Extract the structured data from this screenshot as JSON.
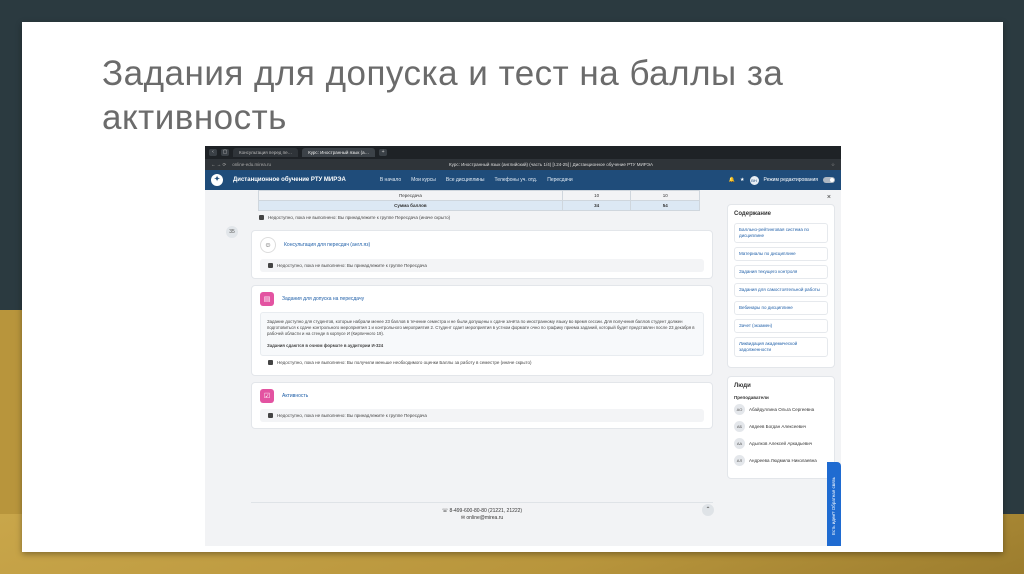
{
  "slide": {
    "title": "Задания для допуска и тест на баллы за активность"
  },
  "browser": {
    "tabs": [
      "Консультация перед пе…",
      "Курс: Иностранный язык (а…"
    ],
    "url": "online-edu.mirea.ru",
    "page_title": "Курс: Иностранный язык (английский) (часть 1/4) [I.24-25] | Дистанционное обучение РТУ МИРЭА"
  },
  "appbar": {
    "brand": "Дистанционное обучение РТУ МИРЭА",
    "nav": [
      "В начало",
      "Мои курсы",
      "Все дисциплины",
      "Телефоны уч. отд.",
      "Пересдачи"
    ],
    "avatar": "ВН",
    "edit_mode": "Режим редактирования"
  },
  "left_btn": "35",
  "table": {
    "rows": [
      [
        "Пересдача",
        "10",
        "10"
      ],
      [
        "Сумма баллов",
        "34",
        "54"
      ]
    ]
  },
  "main": {
    "restrict1": "Недоступно, пока не выполнено: Вы принадлежите к группе Пересдача (иначе скрыто)",
    "consult_link": "Консультация для пересдач (англ.яз)",
    "restrict2": "Недоступно, пока не выполнено: Вы принадлежите к группе Пересдача",
    "assign_link": "Задания для допуска на пересдачу",
    "desc_text": "Задание доступно для студентов, которые набрали менее 23 баллов в течение семестра и не были допущены к сдаче зачёта по иностранному языку во время сессии. Для получения баллов студент должен подготовиться к сдаче контрольного мероприятия 1 и контрольного мероприятия 2. Студент сдает мероприятия в устном формате очно по графику приема заданий, который будет представлен после 23 декабря в рабочей области и на стенде в корпусе И (Кирпичного 19).",
    "desc_bold": "Задания сдаются в очном формате в аудитории И-324",
    "restrict3": "Недоступно, пока не выполнено: Вы получили меньше необходимого оценки Баллы за работу в семестре (иначе скрыто)",
    "activity_link": "Активность",
    "restrict4": "Недоступно, пока не выполнено: Вы принадлежите к группе Пересдача"
  },
  "footer": {
    "phone": "8-499-600-80-80 (21221, 21222)",
    "email": "online@mirea.ru"
  },
  "sidebar": {
    "contents_title": "Содержание",
    "toc": [
      "Балльно-рейтинговая система по дисциплине",
      "Материалы по дисциплине",
      "Задания текущего контроля",
      "Задания для самостоятельной работы",
      "Вебинары по дисциплине",
      "Зачет (экзамен)",
      "Ликвидация академической задолженности"
    ],
    "people_title": "Люди",
    "role": "Преподаватели",
    "people": [
      {
        "initials": "АО",
        "name": "Абайдуллина Ольга Сергеевна"
      },
      {
        "initials": "АБ",
        "name": "Авдеев Богдан Алексеевич"
      },
      {
        "initials": "АА",
        "name": "Адылков Алексей Аркадьевич"
      },
      {
        "initials": "АЛ",
        "name": "Андреева Людмила Николаевна"
      }
    ],
    "feedback": "Есть идеи? Обратная связь"
  }
}
